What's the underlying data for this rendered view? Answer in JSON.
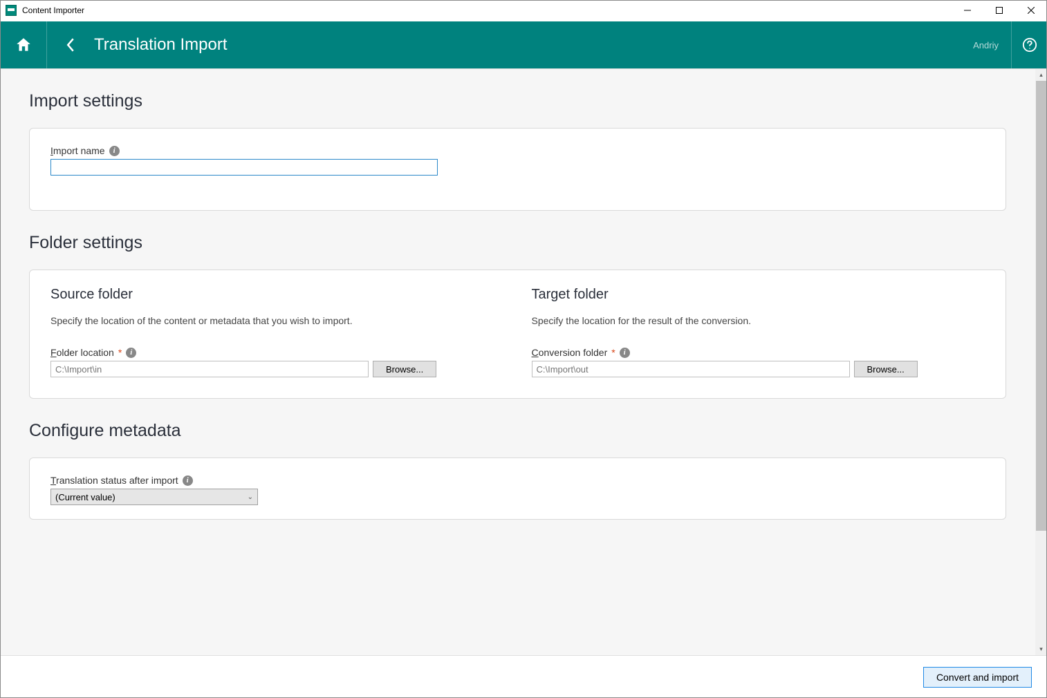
{
  "window": {
    "title": "Content Importer"
  },
  "header": {
    "title": "Translation Import",
    "user": "Andriy"
  },
  "sections": {
    "import_settings_title": "Import settings",
    "import_name_label": "Import name",
    "import_name_value": "",
    "folder_settings_title": "Folder settings",
    "source": {
      "title": "Source folder",
      "desc": "Specify the location of the content or metadata that you wish to import.",
      "label": "Folder location",
      "placeholder": "C:\\Import\\in",
      "browse": "Browse..."
    },
    "target": {
      "title": "Target folder",
      "desc": "Specify the location for the result of the conversion.",
      "label": "Conversion folder",
      "placeholder": "C:\\Import\\out",
      "browse": "Browse..."
    },
    "configure_title": "Configure metadata",
    "translation_status_label": "Translation status after import",
    "translation_status_value": "(Current value)"
  },
  "footer": {
    "primary": "Convert and import"
  }
}
